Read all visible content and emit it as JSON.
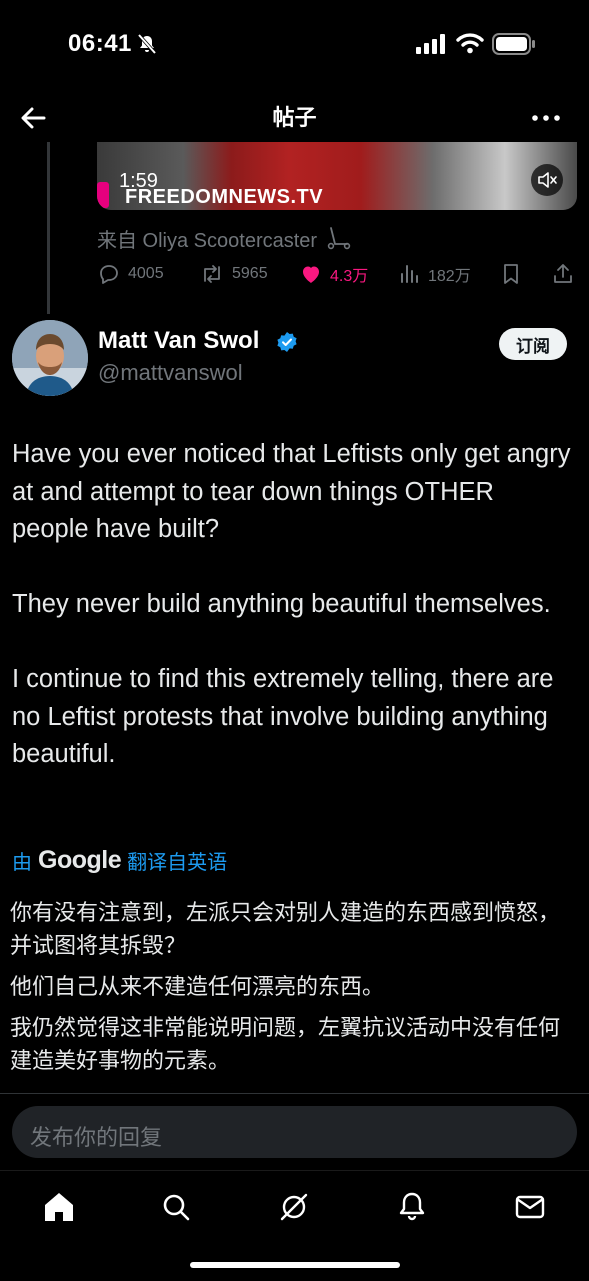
{
  "status_bar": {
    "time": "06:41"
  },
  "header": {
    "title": "帖子"
  },
  "quoted_post": {
    "video_time": "1:59",
    "video_watermark": "FREEDOMNEWS.TV",
    "source": "来自 Oliya Scootercaster",
    "actions": {
      "replies": "4005",
      "reposts": "5965",
      "likes": "4.3万",
      "views": "182万"
    },
    "like_color": "#f91880"
  },
  "post": {
    "author_name": "Matt Van Swol",
    "author_handle": "@mattvanswol",
    "subscribe_label": "订阅",
    "paragraphs": [
      "Have you ever noticed that Leftists only get angry at and attempt to tear down things OTHER people have built?",
      "They never build anything beautiful themselves.",
      "I continue to find this extremely telling, there are no Leftist protests that involve building anything beautiful."
    ],
    "translate_prefix": "由",
    "translate_brand": "Google",
    "translate_suffix": "翻译自英语",
    "translation": [
      "你有没有注意到，左派只会对别人建造的东西感到愤怒，并试图将其拆毁？",
      "他们自己从来不建造任何漂亮的东西。",
      "我仍然觉得这非常能说明问题，左翼抗议活动中没有任何建造美好事物的元素。"
    ]
  },
  "reply": {
    "placeholder": "发布你的回复"
  },
  "colors": {
    "accent": "#1d9bf0",
    "background": "#000000",
    "secondary_text": "#71767b"
  },
  "nav_icons": [
    "home-icon",
    "search-icon",
    "grok-icon",
    "notifications-icon",
    "messages-icon"
  ]
}
